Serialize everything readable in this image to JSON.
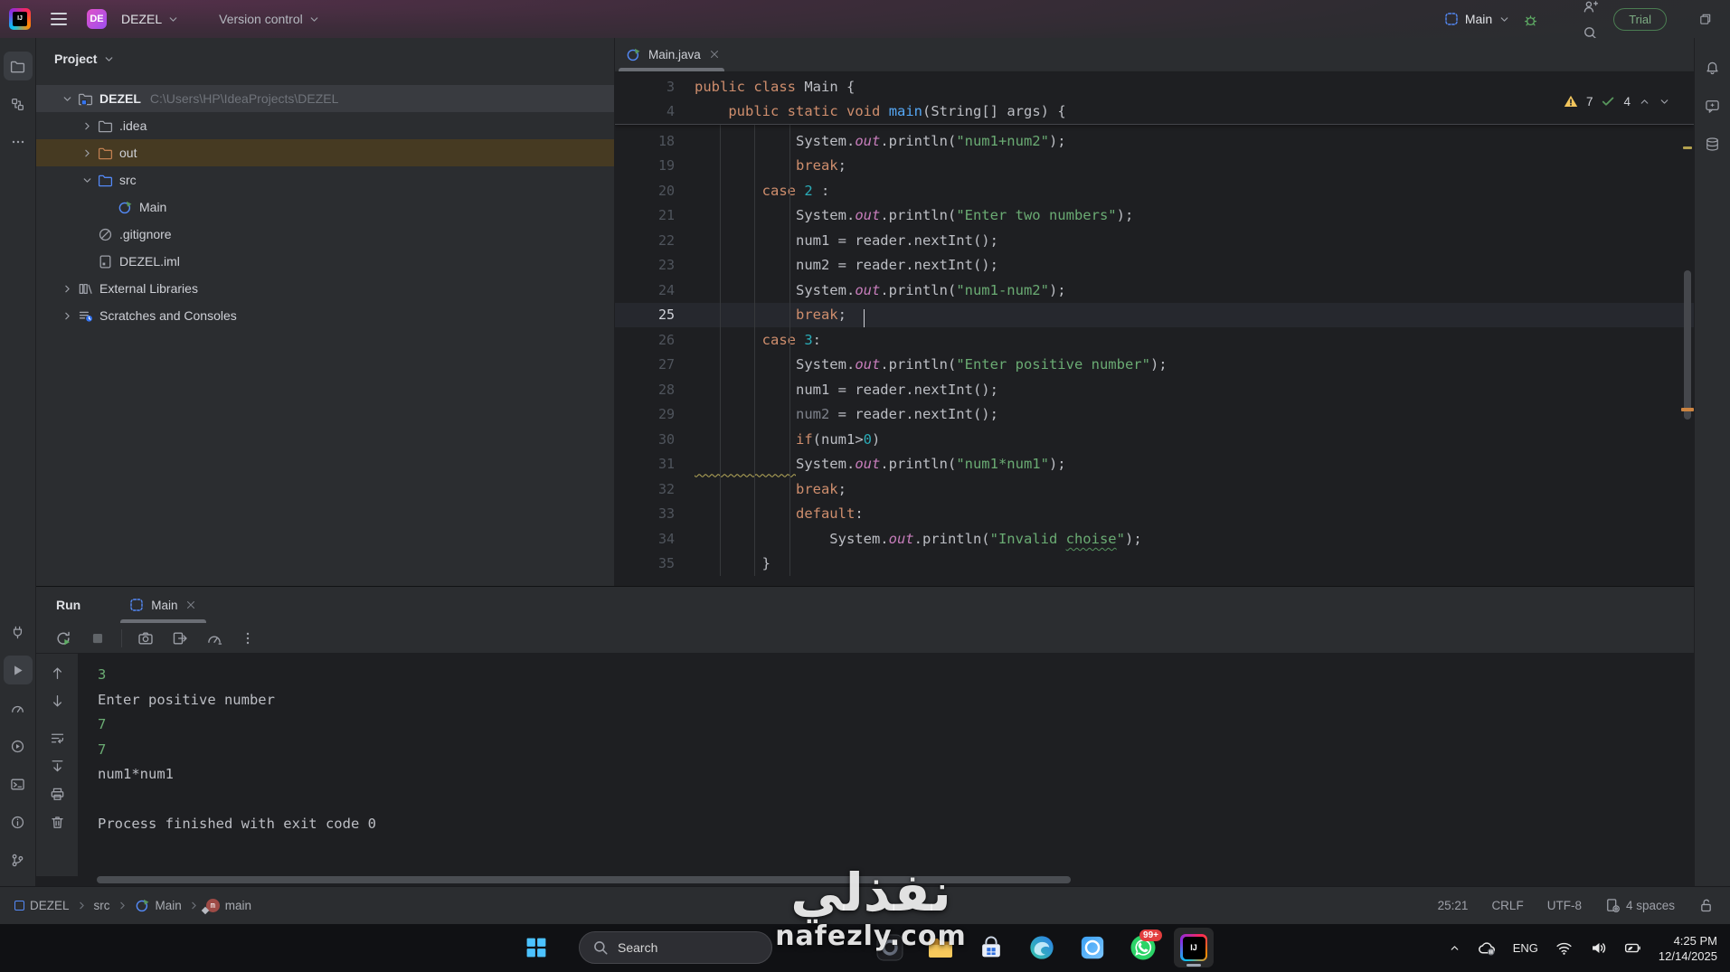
{
  "titlebar": {
    "project_badge": "DE",
    "project_name": "DEZEL",
    "version_control_label": "Version control",
    "run_config_label": "Main",
    "run_icons": [
      "run-icon",
      "debug-icon",
      "more-actions-icon"
    ],
    "right_icons": [
      "ai-assistant-icon",
      "code-with-me-icon",
      "search-everywhere-icon",
      "settings-icon"
    ],
    "trial_label": "Trial",
    "window_icons": [
      "minimize-icon",
      "maximize-icon",
      "close-icon"
    ]
  },
  "left_stripe": {
    "top_icons": [
      {
        "name": "project-tool-icon",
        "active": true
      },
      {
        "name": "structure-tool-icon",
        "active": false
      },
      {
        "name": "more-tools-icon",
        "active": false
      }
    ],
    "bottom_icons": [
      {
        "name": "build-tool-icon",
        "active": false
      },
      {
        "name": "run-tool-icon",
        "active": true
      },
      {
        "name": "profiler-tool-icon",
        "active": false
      },
      {
        "name": "services-tool-icon",
        "active": false
      },
      {
        "name": "terminal-tool-icon",
        "active": false
      },
      {
        "name": "problems-tool-icon",
        "active": false
      },
      {
        "name": "version-control-tool-icon",
        "active": false
      }
    ]
  },
  "right_stripe": {
    "icons": [
      {
        "name": "notifications-icon"
      },
      {
        "name": "ai-chat-icon"
      },
      {
        "name": "database-tool-icon"
      }
    ]
  },
  "project_panel": {
    "title": "Project",
    "tree": [
      {
        "label": "DEZEL",
        "path": "C:\\Users\\HP\\IdeaProjects\\DEZEL",
        "depth": 0,
        "chevron": "down",
        "icon": "project-folder-icon",
        "state": "selected"
      },
      {
        "label": ".idea",
        "depth": 1,
        "chevron": "right",
        "icon": "folder-icon",
        "state": ""
      },
      {
        "label": "out",
        "depth": 1,
        "chevron": "right",
        "icon": "folder-excluded-icon",
        "state": "excluded"
      },
      {
        "label": "src",
        "depth": 1,
        "chevron": "down",
        "icon": "folder-src-icon",
        "state": ""
      },
      {
        "label": "Main",
        "depth": 2,
        "chevron": "none",
        "icon": "java-class-icon",
        "state": ""
      },
      {
        "label": ".gitignore",
        "depth": 1,
        "chevron": "none",
        "icon": "ignored-file-icon",
        "state": ""
      },
      {
        "label": "DEZEL.iml",
        "depth": 1,
        "chevron": "none",
        "icon": "iml-file-icon",
        "state": ""
      },
      {
        "label": "External Libraries",
        "depth": 0,
        "chevron": "right",
        "icon": "libraries-icon",
        "state": ""
      },
      {
        "label": "Scratches and Consoles",
        "depth": 0,
        "chevron": "right",
        "icon": "scratches-icon",
        "state": ""
      }
    ]
  },
  "editor": {
    "tab_label": "Main.java",
    "inspections": {
      "warning_count": "7",
      "ok_count": "4"
    },
    "sticky_lines": [
      {
        "n": "3",
        "t": [
          [
            "k",
            "public"
          ],
          [
            "d",
            " "
          ],
          [
            "k",
            "class"
          ],
          [
            "d",
            " Main {"
          ]
        ]
      },
      {
        "n": "4",
        "t": [
          [
            "d",
            "    "
          ],
          [
            "k",
            "public"
          ],
          [
            "d",
            " "
          ],
          [
            "k",
            "static"
          ],
          [
            "d",
            " "
          ],
          [
            "k",
            "void"
          ],
          [
            "d",
            " "
          ],
          [
            "m",
            "main"
          ],
          [
            "d",
            "(String[] args) {"
          ]
        ]
      }
    ],
    "lines": [
      {
        "n": "18",
        "t": [
          [
            "d",
            "            System."
          ],
          [
            "f",
            "out"
          ],
          [
            "d",
            ".println("
          ],
          [
            "s",
            "\"num1+num2\""
          ],
          [
            "d",
            ");"
          ]
        ]
      },
      {
        "n": "19",
        "t": [
          [
            "d",
            "            "
          ],
          [
            "k",
            "break"
          ],
          [
            "d",
            ";"
          ]
        ]
      },
      {
        "n": "20",
        "t": [
          [
            "d",
            "        "
          ],
          [
            "k",
            "case"
          ],
          [
            "d",
            " "
          ],
          [
            "nm",
            "2"
          ],
          [
            "d",
            " :"
          ]
        ]
      },
      {
        "n": "21",
        "t": [
          [
            "d",
            "            System."
          ],
          [
            "f",
            "out"
          ],
          [
            "d",
            ".println("
          ],
          [
            "s",
            "\"Enter two numbers\""
          ],
          [
            "d",
            ");"
          ]
        ]
      },
      {
        "n": "22",
        "t": [
          [
            "d",
            "            num1 = reader.nextInt();"
          ]
        ]
      },
      {
        "n": "23",
        "t": [
          [
            "d",
            "            num2 = reader.nextInt();"
          ]
        ]
      },
      {
        "n": "24",
        "t": [
          [
            "d",
            "            System."
          ],
          [
            "f",
            "out"
          ],
          [
            "d",
            ".println("
          ],
          [
            "s",
            "\"num1-num2\""
          ],
          [
            "d",
            ");"
          ]
        ]
      },
      {
        "n": "25",
        "cur": true,
        "t": [
          [
            "d",
            "            "
          ],
          [
            "k",
            "break"
          ],
          [
            "d",
            ";"
          ]
        ]
      },
      {
        "n": "26",
        "t": [
          [
            "d",
            "        "
          ],
          [
            "k",
            "case"
          ],
          [
            "d",
            " "
          ],
          [
            "nm",
            "3"
          ],
          [
            "d",
            ":"
          ]
        ]
      },
      {
        "n": "27",
        "t": [
          [
            "d",
            "            System."
          ],
          [
            "f",
            "out"
          ],
          [
            "d",
            ".println("
          ],
          [
            "s",
            "\"Enter positive number\""
          ],
          [
            "d",
            ");"
          ]
        ]
      },
      {
        "n": "28",
        "t": [
          [
            "d",
            "            num1 = reader.nextInt();"
          ]
        ]
      },
      {
        "n": "29",
        "t": [
          [
            "d",
            "            "
          ],
          [
            "dim",
            "num2"
          ],
          [
            "d",
            " = reader.nextInt();"
          ]
        ]
      },
      {
        "n": "30",
        "t": [
          [
            "d",
            "            "
          ],
          [
            "k",
            "if"
          ],
          [
            "d",
            "(num1>"
          ],
          [
            "nm",
            "0"
          ],
          [
            "d",
            ")"
          ]
        ]
      },
      {
        "n": "31",
        "t": [
          [
            "wsq",
            "            "
          ],
          [
            "d",
            "System."
          ],
          [
            "f",
            "out"
          ],
          [
            "d",
            ".println("
          ],
          [
            "s",
            "\"num1*num1\""
          ],
          [
            "d",
            ");"
          ]
        ]
      },
      {
        "n": "32",
        "t": [
          [
            "d",
            "            "
          ],
          [
            "k",
            "break"
          ],
          [
            "d",
            ";"
          ]
        ]
      },
      {
        "n": "33",
        "t": [
          [
            "d",
            "            "
          ],
          [
            "k",
            "default"
          ],
          [
            "d",
            ":"
          ]
        ]
      },
      {
        "n": "34",
        "t": [
          [
            "d",
            "                System."
          ],
          [
            "f",
            "out"
          ],
          [
            "d",
            ".println("
          ],
          [
            "s",
            "\"Invalid "
          ],
          [
            "tsq",
            "choise"
          ],
          [
            "s",
            "\""
          ],
          [
            "d",
            ");"
          ]
        ]
      },
      {
        "n": "35",
        "t": [
          [
            "d",
            "        }"
          ]
        ]
      }
    ],
    "caret_col": 20
  },
  "run_panel": {
    "title": "Run",
    "tab_label": "Main",
    "toolbar_icons": [
      "rerun-icon",
      "stop-icon",
      "camera-icon",
      "open-results-icon",
      "profiler-snapshot-icon",
      "more-actions-icon"
    ],
    "console_toolbar_icons": [
      "arrow-up-icon",
      "arrow-down-icon",
      "soft-wrap-icon",
      "scroll-to-end-icon",
      "print-icon",
      "clear-all-icon"
    ],
    "console": [
      {
        "text": "3",
        "kind": "input"
      },
      {
        "text": "Enter positive number",
        "kind": "out"
      },
      {
        "text": "7",
        "kind": "input"
      },
      {
        "text": "7",
        "kind": "input"
      },
      {
        "text": "num1*num1",
        "kind": "out"
      },
      {
        "text": " ",
        "kind": "out"
      },
      {
        "text": "Process finished with exit code 0",
        "kind": "out"
      }
    ]
  },
  "status_bar": {
    "crumbs": [
      {
        "icon": "module-icon",
        "label": "DEZEL"
      },
      {
        "icon": "",
        "label": "src"
      },
      {
        "icon": "java-class-icon",
        "label": "Main"
      },
      {
        "icon": "method-icon",
        "label": "main"
      }
    ],
    "caret_position": "25:21",
    "line_separator": "CRLF",
    "encoding": "UTF-8",
    "indent": "4 spaces"
  },
  "taskbar": {
    "search_label": "Search",
    "apps": [
      {
        "icon": "copilot-icon",
        "badge": "",
        "active": false
      },
      {
        "icon": "file-explorer-icon",
        "badge": "",
        "active": false
      },
      {
        "icon": "store-icon",
        "badge": "",
        "active": false
      },
      {
        "icon": "edge-icon",
        "badge": "",
        "active": false
      },
      {
        "icon": "photos-icon",
        "badge": "",
        "active": false
      },
      {
        "icon": "whatsapp-icon",
        "badge": "99+",
        "active": false
      },
      {
        "icon": "intellij-icon",
        "badge": "",
        "active": true
      }
    ],
    "tray": {
      "language": "ENG",
      "time": "4:25 PM",
      "date": "12/14/2025"
    }
  },
  "watermark": {
    "title": "نفذلي",
    "subtitle": "nafezly.com"
  },
  "colors": {
    "accent_green": "#5FAD65",
    "warning_yellow": "#F2C55C",
    "keyword": "#CF8E6D",
    "string": "#6AAB73",
    "number": "#2AACB8",
    "field": "#C77DBB",
    "method_decl": "#56A8F5",
    "excluded_row": "#463A22",
    "selected_row": "#393B40"
  }
}
